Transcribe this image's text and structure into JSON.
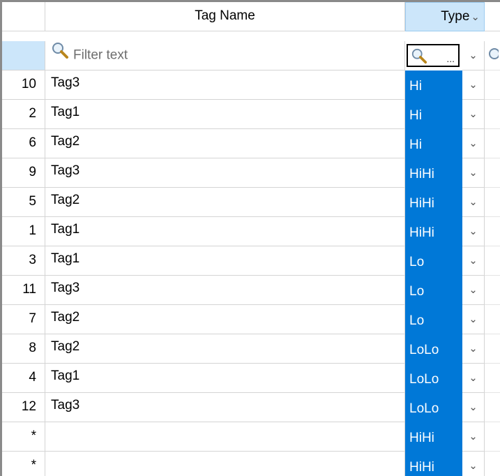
{
  "header": {
    "tag_name_label": "Tag Name",
    "type_label": "Type",
    "type_sort_icon": "chevron-down-icon"
  },
  "filter": {
    "placeholder": "Filter text",
    "type_filter_dots": "...",
    "search_icon": "search-icon"
  },
  "rows": [
    {
      "num": "10",
      "name": "Tag3",
      "type": "Hi"
    },
    {
      "num": "2",
      "name": "Tag1",
      "type": "Hi"
    },
    {
      "num": "6",
      "name": "Tag2",
      "type": "Hi"
    },
    {
      "num": "9",
      "name": "Tag3",
      "type": "HiHi"
    },
    {
      "num": "5",
      "name": "Tag2",
      "type": "HiHi"
    },
    {
      "num": "1",
      "name": "Tag1",
      "type": "HiHi"
    },
    {
      "num": "3",
      "name": "Tag1",
      "type": "Lo"
    },
    {
      "num": "11",
      "name": "Tag3",
      "type": "Lo"
    },
    {
      "num": "7",
      "name": "Tag2",
      "type": "Lo"
    },
    {
      "num": "8",
      "name": "Tag2",
      "type": "LoLo"
    },
    {
      "num": "4",
      "name": "Tag1",
      "type": "LoLo"
    },
    {
      "num": "12",
      "name": "Tag3",
      "type": "LoLo"
    },
    {
      "num": "*",
      "name": "",
      "type": "HiHi"
    },
    {
      "num": "*",
      "name": "",
      "type": "HiHi"
    }
  ],
  "colors": {
    "selection": "#0078d7",
    "header_highlight": "#cce6fa"
  }
}
